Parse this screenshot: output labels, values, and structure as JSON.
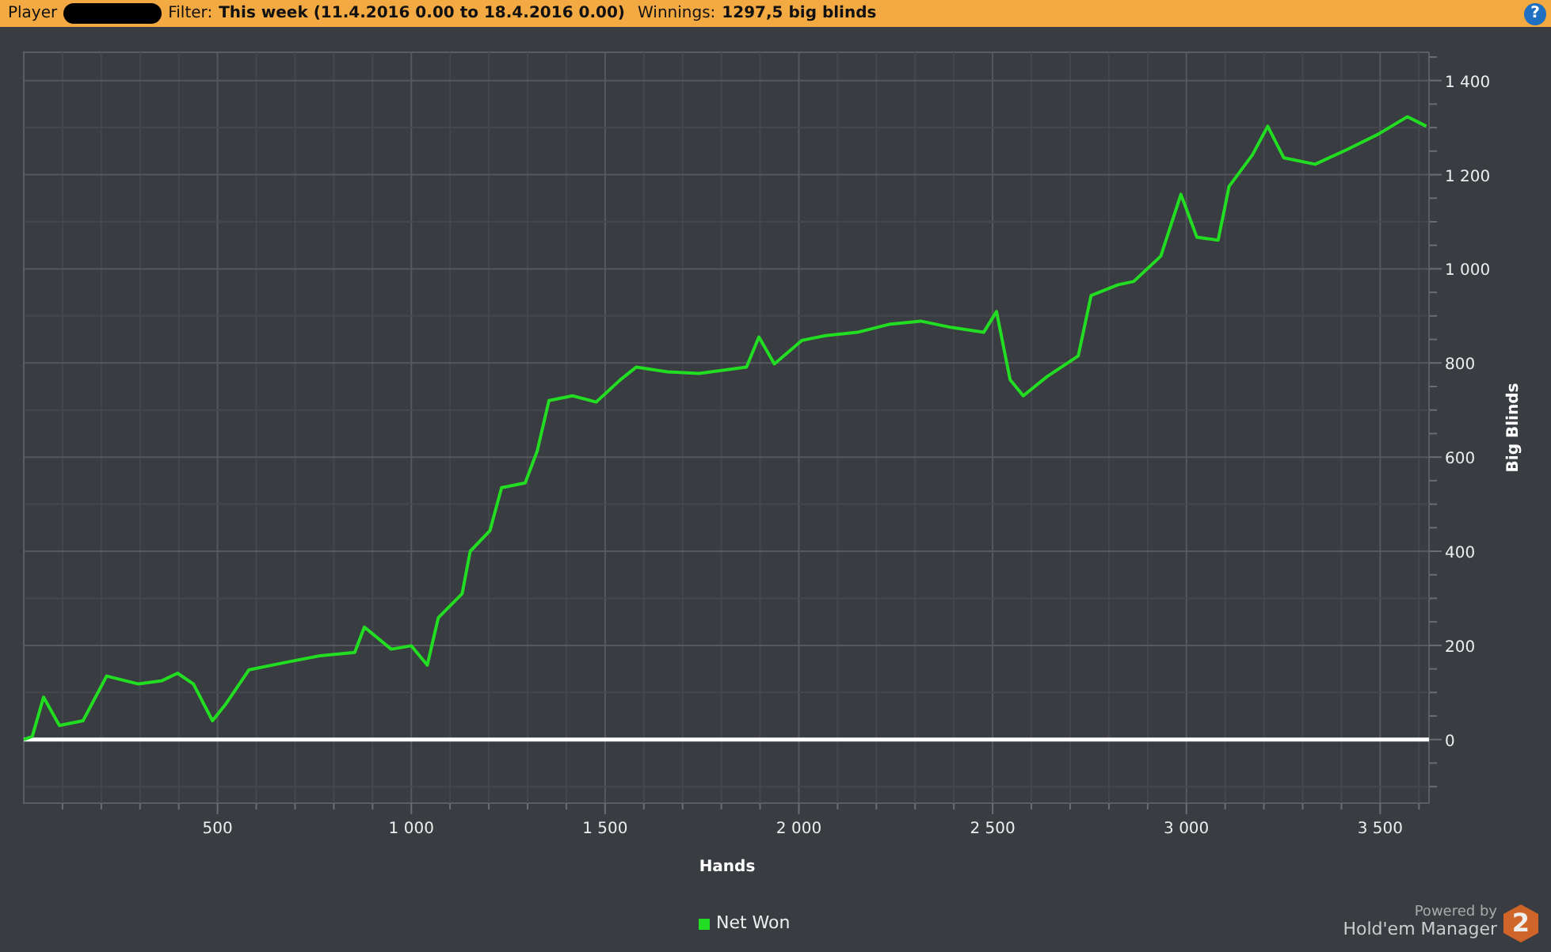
{
  "header": {
    "player_label": "Player",
    "filter_label": "Filter:",
    "filter_value": "This week (11.4.2016 0.00 to 18.4.2016 0.00)",
    "winnings_label": "Winnings:",
    "winnings_value": "1297,5 big blinds",
    "help": "?"
  },
  "chart": {
    "chart_data": {
      "type": "line",
      "grid": true,
      "xlabel": "Hands",
      "ylabel": "Big Blinds",
      "xlim": [
        0,
        3626
      ],
      "ylim": [
        -135,
        1460
      ],
      "xticks": [
        {
          "value": 500,
          "label": "500"
        },
        {
          "value": 1000,
          "label": "1 000"
        },
        {
          "value": 1500,
          "label": "1 500"
        },
        {
          "value": 2000,
          "label": "2 000"
        },
        {
          "value": 2500,
          "label": "2 500"
        },
        {
          "value": 3000,
          "label": "3 000"
        },
        {
          "value": 3500,
          "label": "3 500"
        }
      ],
      "yticks": [
        {
          "value": 0,
          "label": "0"
        },
        {
          "value": 200,
          "label": "200"
        },
        {
          "value": 400,
          "label": "400"
        },
        {
          "value": 600,
          "label": "600"
        },
        {
          "value": 800,
          "label": "800"
        },
        {
          "value": 1000,
          "label": "1 000"
        },
        {
          "value": 1200,
          "label": "1 200"
        },
        {
          "value": 1400,
          "label": "1 400"
        }
      ],
      "x": [
        0,
        22,
        51,
        92,
        153,
        214,
        296,
        357,
        397,
        438,
        487,
        520,
        581,
        683,
        764,
        854,
        879,
        948,
        1000,
        1041,
        1070,
        1131,
        1152,
        1203,
        1233,
        1294,
        1325,
        1355,
        1416,
        1477,
        1539,
        1580,
        1661,
        1743,
        1865,
        1897,
        1937,
        2008,
        2069,
        2151,
        2232,
        2314,
        2395,
        2477,
        2510,
        2545,
        2579,
        2640,
        2721,
        2754,
        2823,
        2864,
        2934,
        2986,
        3027,
        3082,
        3110,
        3170,
        3210,
        3251,
        3332,
        3414,
        3495,
        3570,
        3619
      ],
      "series": [
        {
          "name": "Net Won",
          "color": "#22dd22",
          "values": [
            0,
            7,
            90,
            30,
            40,
            135,
            118,
            125,
            141,
            118,
            40,
            74,
            148,
            165,
            178,
            185,
            239,
            192,
            199,
            158,
            259,
            310,
            400,
            444,
            535,
            545,
            613,
            720,
            730,
            717,
            764,
            791,
            781,
            778,
            791,
            855,
            798,
            848,
            858,
            865,
            882,
            889,
            875,
            865,
            909,
            764,
            730,
            771,
            815,
            943,
            966,
            973,
            1027,
            1158,
            1067,
            1061,
            1175,
            1242,
            1303,
            1236,
            1222,
            1253,
            1286,
            1323,
            1303
          ]
        }
      ]
    }
  },
  "branding": {
    "powered_by": "Powered by",
    "product": "Hold'em Manager",
    "badge": "2"
  }
}
